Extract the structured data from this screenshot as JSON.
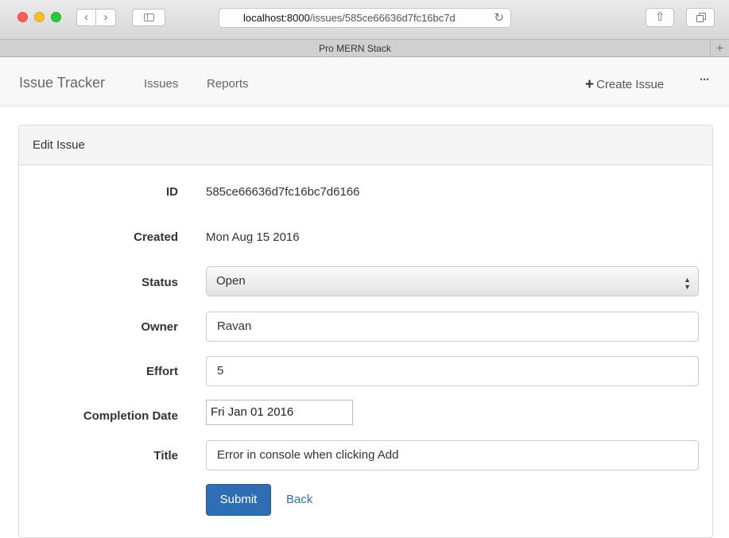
{
  "browser": {
    "url_host": "localhost:8000",
    "url_path": "/issues/585ce66636d7fc16bc7d",
    "tab_title": "Pro MERN Stack",
    "back_glyph": "‹",
    "forward_glyph": "›",
    "reload_glyph": "↻",
    "share_glyph": "⇧",
    "new_tab_glyph": "+"
  },
  "app_nav": {
    "brand": "Issue Tracker",
    "links": [
      "Issues",
      "Reports"
    ],
    "create_issue": "Create Issue",
    "more": "···"
  },
  "panel": {
    "heading": "Edit Issue"
  },
  "form": {
    "id_label": "ID",
    "id_value": "585ce66636d7fc16bc7d6166",
    "created_label": "Created",
    "created_value": "Mon Aug 15 2016",
    "status_label": "Status",
    "status_value": "Open",
    "owner_label": "Owner",
    "owner_value": "Ravan",
    "effort_label": "Effort",
    "effort_value": "5",
    "completion_label": "Completion Date",
    "completion_value": "Fri Jan 01 2016",
    "title_label": "Title",
    "title_value": "Error in console when clicking Add",
    "submit": "Submit",
    "back": "Back"
  },
  "colors": {
    "primary": "#2f6db5",
    "navbar_bg": "#f8f8f8",
    "panel_heading_bg": "#f5f5f5"
  }
}
